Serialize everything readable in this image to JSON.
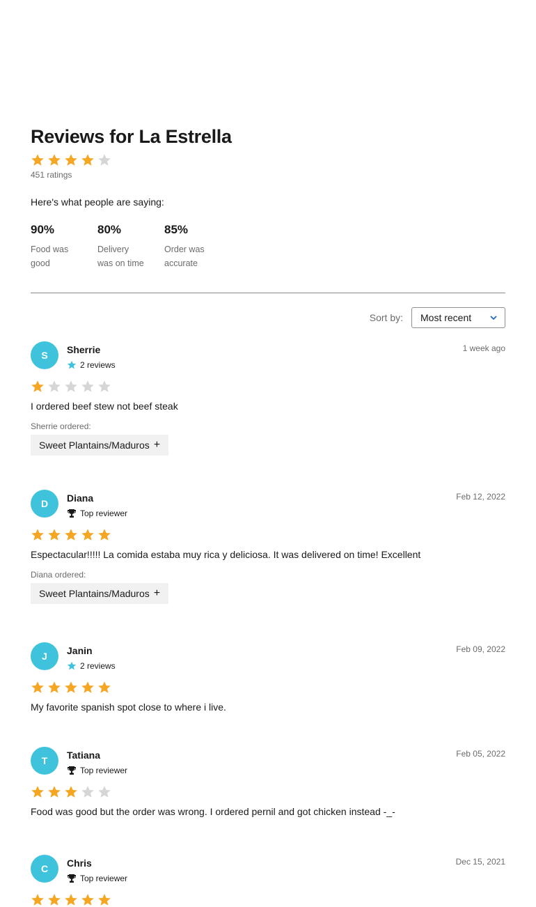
{
  "page": {
    "title": "Reviews for La Estrella",
    "overall_rating": 4,
    "ratings_count": "451 ratings",
    "saying": "Here's what people are saying:"
  },
  "stats": [
    {
      "pct": "90%",
      "label": "Food was good"
    },
    {
      "pct": "80%",
      "label": "Delivery was on time"
    },
    {
      "pct": "85%",
      "label": "Order was accurate"
    }
  ],
  "sort": {
    "label": "Sort by:",
    "value": "Most recent"
  },
  "colors": {
    "star_on": "#f5a623",
    "star_off": "#d6d6d6",
    "avatar": "#3fc3dd",
    "badge_star": "#3fc3dd"
  },
  "reviews": [
    {
      "initial": "S",
      "name": "Sherrie",
      "badge_icon": "star-icon",
      "badge": "2 reviews",
      "date": "1 week ago",
      "rating": 1,
      "text": "I ordered beef stew not beef steak",
      "ordered_label": "Sherrie ordered:",
      "item": "Sweet Plantains/Maduros"
    },
    {
      "initial": "D",
      "name": "Diana",
      "badge_icon": "trophy-icon",
      "badge": "Top reviewer",
      "date": "Feb 12, 2022",
      "rating": 5,
      "text": "Espectacular!!!!! La comida estaba muy rica y deliciosa. It was delivered on time! Excellent",
      "ordered_label": "Diana ordered:",
      "item": "Sweet Plantains/Maduros"
    },
    {
      "initial": "J",
      "name": "Janin",
      "badge_icon": "star-icon",
      "badge": "2 reviews",
      "date": "Feb 09, 2022",
      "rating": 5,
      "text": "My favorite spanish spot close to where i live."
    },
    {
      "initial": "T",
      "name": "Tatiana",
      "badge_icon": "trophy-icon",
      "badge": "Top reviewer",
      "date": "Feb 05, 2022",
      "rating": 3,
      "text": "Food was good but the order was wrong. I ordered pernil and got chicken instead -_-"
    },
    {
      "initial": "C",
      "name": "Chris",
      "badge_icon": "trophy-icon",
      "badge": "Top reviewer",
      "date": "Dec 15, 2021",
      "rating": 5,
      "text": ""
    }
  ]
}
